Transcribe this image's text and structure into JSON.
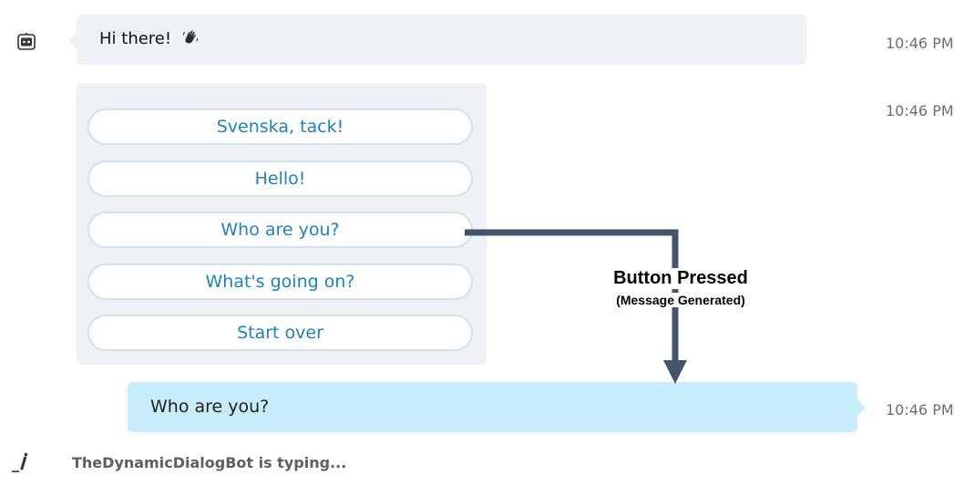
{
  "chat": {
    "bot_greeting": {
      "text": "Hi there!",
      "emoji_icon": "waving-hand-icon",
      "time": "10:46 PM"
    },
    "card": {
      "time": "10:46 PM",
      "buttons": [
        {
          "label": "Svenska, tack!"
        },
        {
          "label": "Hello!"
        },
        {
          "label": "Who are you?"
        },
        {
          "label": "What's going on?"
        },
        {
          "label": "Start over"
        }
      ]
    },
    "user_message": {
      "text": "Who are you?",
      "time": "10:46 PM"
    },
    "typing_indicator": {
      "text": "TheDynamicDialogBot is typing..."
    }
  },
  "annotation": {
    "title": "Button Pressed",
    "subtitle": "(Message Generated)",
    "arrow_color": "#44546a"
  },
  "colors": {
    "bot_bubble": "#eef1f5",
    "user_bubble": "#c7ecfb",
    "button_text": "#1a82c6",
    "button_border": "#cfe2ef",
    "timestamp": "#6b6f73"
  },
  "icons": {
    "bot_avatar": "bot-avatar-icon",
    "typing": "typing-pen-icon"
  }
}
